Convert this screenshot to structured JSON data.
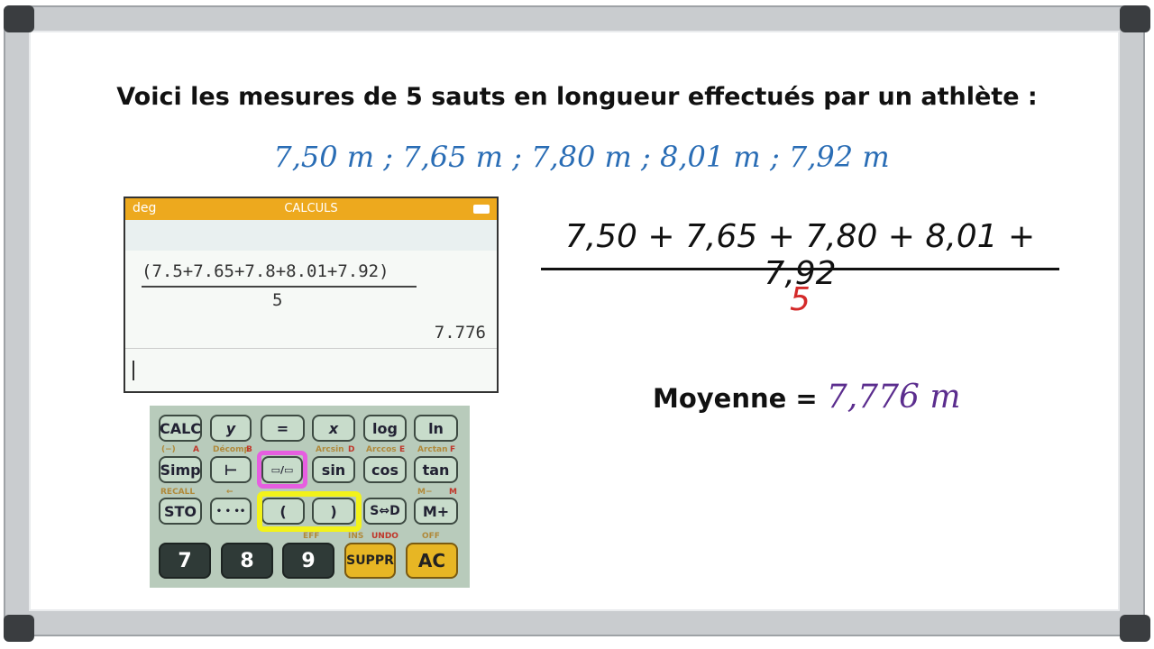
{
  "board": {
    "title": "Voici les mesures de 5 sauts en longueur effectués par un athlète :",
    "measures": "7,50 m ; 7,65 m ; 7,80 m ; 8,01 m ; 7,92 m",
    "numerator": "7,50 + 7,65 + 7,80 + 8,01 + 7,92",
    "denominator": "5",
    "mean_label": "Moyenne = ",
    "mean_value": "7,776 m",
    "colors": {
      "measures": "#2a6db5",
      "denominator": "#d42a2a",
      "mean": "#5b2d8e"
    }
  },
  "calculator": {
    "mode": "deg",
    "app": "CALCULS",
    "battery_icon": "battery-icon",
    "expression": "(7.5+7.65+7.8+8.01+7.92)",
    "divisor": "5",
    "result": "7.776",
    "keys": {
      "row1": [
        "CALC",
        "y",
        "=",
        "x",
        "log",
        "ln"
      ],
      "row2": [
        "Simp",
        "⊢",
        "▭/▭",
        "sin",
        "cos",
        "tan"
      ],
      "row3": [
        "STO",
        "• • ••",
        "(",
        ")",
        "S⇔D",
        "M+"
      ],
      "row4": [
        "7",
        "8",
        "9",
        "SUPPR",
        "AC"
      ]
    },
    "secondary": {
      "row2": [
        "(−)",
        "A",
        "Décomp",
        "B",
        "Arcsin",
        "D",
        "Arccos",
        "E",
        "Arctan",
        "F"
      ],
      "row3": [
        "RECALL",
        "←",
        "M−",
        "M"
      ],
      "row4": [
        "EFF",
        "INS",
        "UNDO",
        "OFF"
      ]
    },
    "highlights": {
      "fraction_key": "#e65ee0",
      "parentheses_keys": "#f2f21a"
    }
  }
}
